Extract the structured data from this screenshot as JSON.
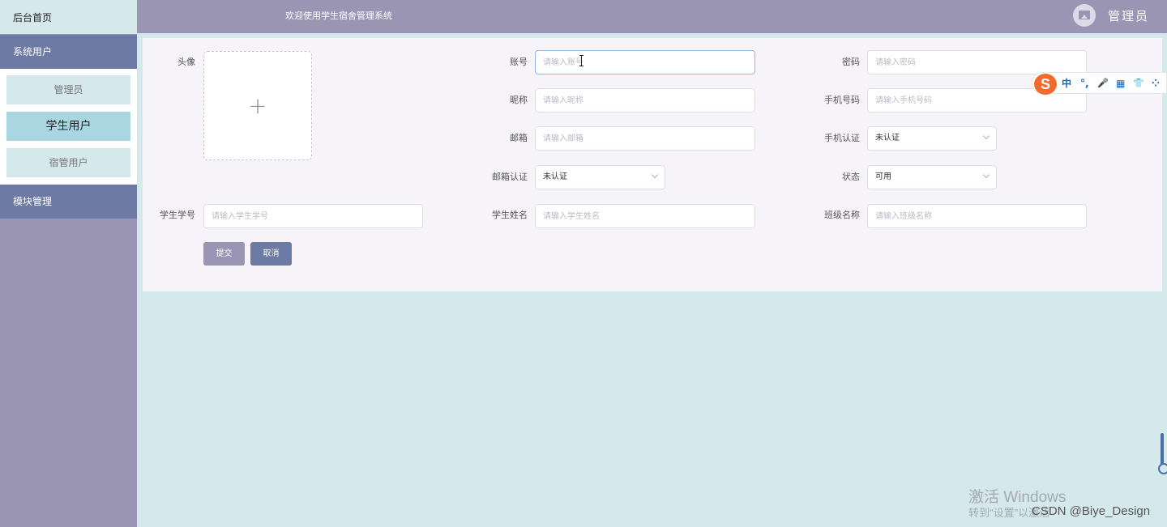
{
  "sidebar": {
    "home": "后台首页",
    "system_users": "系统用户",
    "items": [
      {
        "label": "管理员"
      },
      {
        "label": "学生用户"
      },
      {
        "label": "宿管用户"
      }
    ],
    "module_management": "模块管理"
  },
  "header": {
    "title": "欢迎使用学生宿舍管理系统",
    "user": "管理员"
  },
  "form": {
    "avatar_label": "头像",
    "account": {
      "label": "账号",
      "placeholder": "请输入账号"
    },
    "password": {
      "label": "密码",
      "placeholder": "请输入密码"
    },
    "nickname": {
      "label": "昵称",
      "placeholder": "请输入昵称"
    },
    "phone": {
      "label": "手机号码",
      "placeholder": "请输入手机号码"
    },
    "email": {
      "label": "邮箱",
      "placeholder": "请输入邮箱"
    },
    "phone_verify": {
      "label": "手机认证",
      "value": "未认证"
    },
    "email_verify": {
      "label": "邮箱认证",
      "value": "未认证"
    },
    "status": {
      "label": "状态",
      "value": "可用"
    },
    "student_no": {
      "label": "学生学号",
      "placeholder": "请输入学生学号"
    },
    "student_name": {
      "label": "学生姓名",
      "placeholder": "请输入学生姓名"
    },
    "class_name": {
      "label": "班级名称",
      "placeholder": "请输入班级名称"
    },
    "submit": "提交",
    "cancel": "取消"
  },
  "ime": {
    "logo": "S",
    "items": [
      "中",
      "°,",
      "🎤",
      "▦",
      "👕",
      "⁘"
    ]
  },
  "watermark": {
    "activate": "激活 Windows",
    "hint": "转到\"设置\"以激活",
    "credit": "CSDN @Biye_Design"
  },
  "colors": {
    "sidebar": "#9b95b4",
    "sidebar_group": "#6d7aa4",
    "active_item": "#a9d6e0",
    "background": "#d5e8ec"
  }
}
